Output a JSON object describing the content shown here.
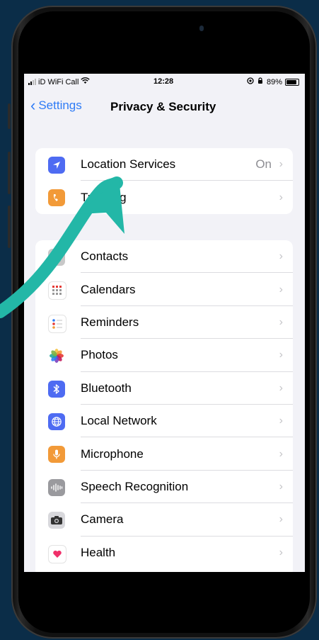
{
  "status_bar": {
    "carrier": "iD WiFi Call",
    "time": "12:28",
    "battery_percent": "89%"
  },
  "nav": {
    "back_label": "Settings",
    "title": "Privacy & Security"
  },
  "group1": [
    {
      "label": "Location Services",
      "value": "On",
      "icon": "location-arrow-icon",
      "color": "#4e6bf2"
    },
    {
      "label": "Tracking",
      "value": "",
      "icon": "tracking-icon",
      "color": "#f29a38"
    }
  ],
  "group2": [
    {
      "label": "Contacts",
      "icon": "contacts-icon",
      "color": "#c8c8c8"
    },
    {
      "label": "Calendars",
      "icon": "calendar-icon",
      "color": "#ffffff"
    },
    {
      "label": "Reminders",
      "icon": "reminders-icon",
      "color": "#ffffff"
    },
    {
      "label": "Photos",
      "icon": "photos-icon",
      "color": "#ffffff"
    },
    {
      "label": "Bluetooth",
      "icon": "bluetooth-icon",
      "color": "#4e6bf2"
    },
    {
      "label": "Local Network",
      "icon": "globe-icon",
      "color": "#4e6bf2"
    },
    {
      "label": "Microphone",
      "icon": "microphone-icon",
      "color": "#f29a38"
    },
    {
      "label": "Speech Recognition",
      "icon": "waveform-icon",
      "color": "#9a9a9e"
    },
    {
      "label": "Camera",
      "icon": "camera-icon",
      "color": "#8e8e93"
    },
    {
      "label": "Health",
      "icon": "heart-icon",
      "color": "#ffffff"
    }
  ],
  "colors": {
    "background": "#0b2d48",
    "accent_blue": "#2f7cf6",
    "arrow_teal": "#23b7a7"
  }
}
